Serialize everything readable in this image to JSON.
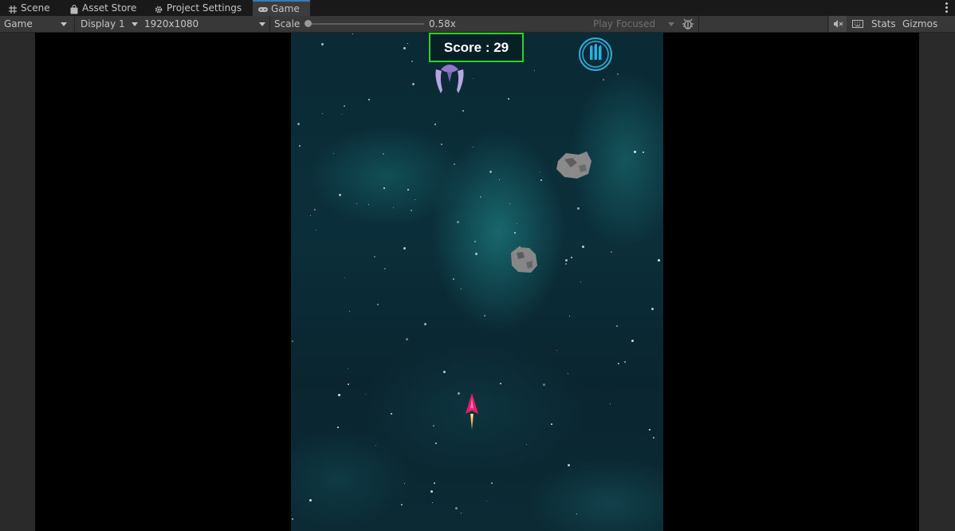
{
  "tabs": [
    {
      "label": "Scene",
      "icon": "hash-grid-icon"
    },
    {
      "label": "Asset Store",
      "icon": "shopping-bag-icon"
    },
    {
      "label": "Project Settings",
      "icon": "gear-icon"
    },
    {
      "label": "Game",
      "icon": "gamepad-icon",
      "active": true
    }
  ],
  "toolbar": {
    "view_mode": "Game",
    "display": "Display 1",
    "resolution": "1920x1080",
    "scale_label": "Scale",
    "scale_value": "0.58x",
    "scale_fraction": 0.0,
    "play_mode": "Play Focused",
    "stats_label": "Stats",
    "gizmos_label": "Gizmos"
  },
  "game": {
    "score_text": "Score : 29"
  },
  "colors": {
    "score_border": "#2bd420",
    "active_tab_accent": "#3a79bb",
    "ammo_icon": "#2ab0e0",
    "ship": "#e0206a"
  }
}
